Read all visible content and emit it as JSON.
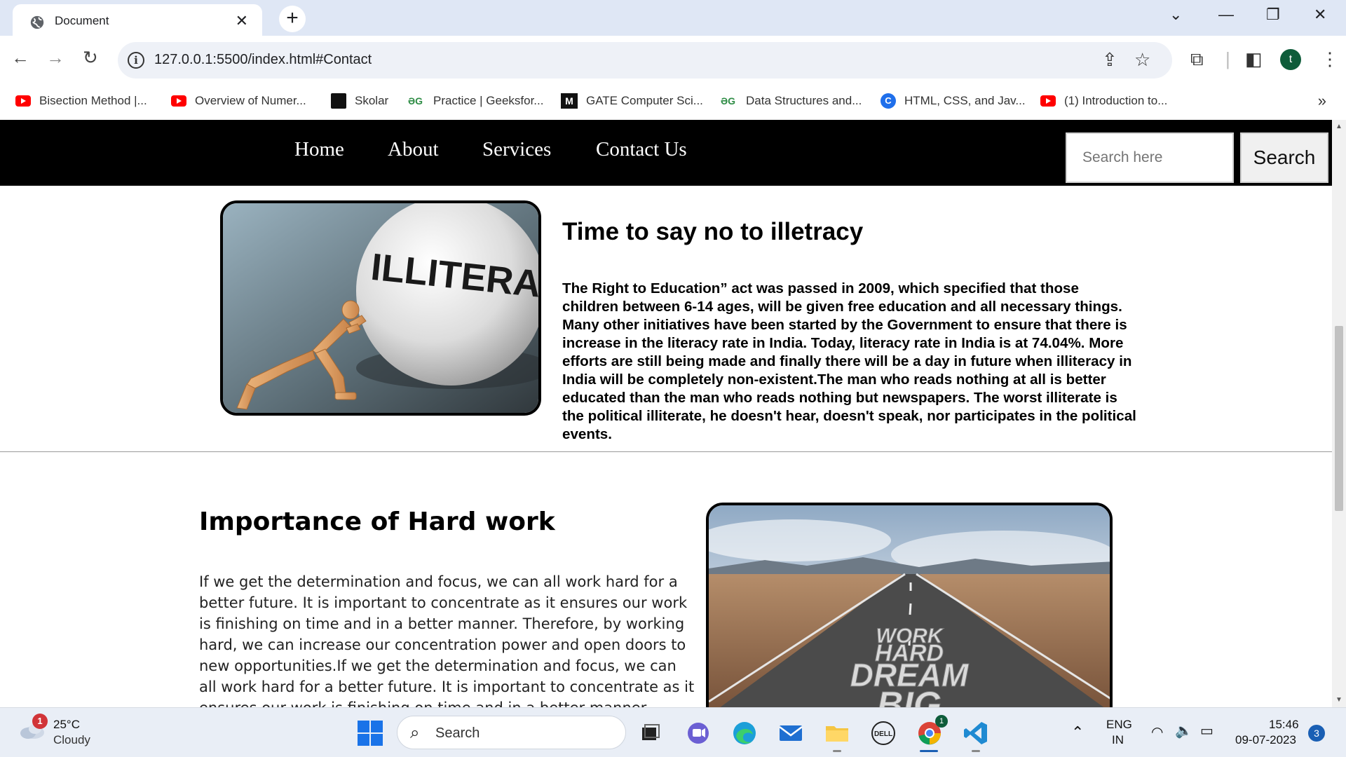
{
  "browser": {
    "tab_title": "Document",
    "url": "127.0.0.1:5500/index.html#Contact",
    "bookmarks": [
      {
        "label": "Bisection Method |...",
        "icon": "youtube-icon"
      },
      {
        "label": "Overview of Numer...",
        "icon": "youtube-icon"
      },
      {
        "label": "Skolar",
        "icon": "skolar-icon"
      },
      {
        "label": "Practice | Geeksfor...",
        "icon": "geeksforgeeks-icon"
      },
      {
        "label": "GATE Computer Sci...",
        "icon": "madeeasy-icon"
      },
      {
        "label": "Data Structures and...",
        "icon": "geeksforgeeks-icon"
      },
      {
        "label": "HTML, CSS, and Jav...",
        "icon": "codewithharry-icon"
      },
      {
        "label": "(1) Introduction to...",
        "icon": "youtube-icon"
      }
    ],
    "profile_initial": "t"
  },
  "site": {
    "nav": [
      "Home",
      "About",
      "Services",
      "Contact Us"
    ],
    "search_placeholder": "Search here",
    "search_button": "Search",
    "section1": {
      "image_text": "ILLITERACY",
      "title": "Time to say no to illetracy",
      "body": "The Right to Education” act was passed in 2009, which specified that those children between 6-14 ages, will be given free education and all necessary things. Many other initiatives have been started by the Government to ensure that there is increase in the literacy rate in India. Today, literacy rate in India is at 74.04%. More efforts are still being made and finally there will be a day in future when illiteracy in India will be completely non-existent.The man who reads nothing at all is better educated than the man who reads nothing but newspapers. The worst illiterate is the political illiterate, he doesn't hear, doesn't speak, nor participates in the political events."
    },
    "section2": {
      "title": "Importance of Hard work",
      "body": "If we get the determination and focus, we can all work hard for a better future. It is important to concentrate as it ensures our work is finishing on time and in a better manner. Therefore, by working hard, we can increase our concentration power and open doors to new opportunities.If we get the determination and focus, we can all work hard for a better future. It is important to concentrate as it ensures our work is finishing on time and in a better manner. Therefore, by working hard",
      "image_lines": [
        "WORK",
        "HARD",
        "DREAM",
        "BIG"
      ]
    }
  },
  "taskbar": {
    "weather_badge": "1",
    "temperature": "25°C",
    "weather": "Cloudy",
    "search_label": "Search",
    "lang_top": "ENG",
    "lang_bottom": "IN",
    "time": "15:46",
    "date": "09-07-2023",
    "notifications": "3",
    "chrome_badge": "1"
  },
  "colors": {
    "nav_bg": "#000000",
    "tabstrip_bg": "#dfe7f5",
    "accent": "#1a5fb4"
  }
}
